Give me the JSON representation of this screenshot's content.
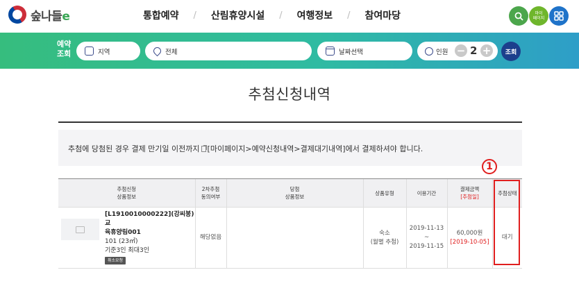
{
  "header": {
    "logo_text": "숲나들",
    "logo_suffix": "e",
    "nav": [
      "통합예약",
      "산림휴양시설",
      "여행정보",
      "참여마당"
    ],
    "separator": "/",
    "mypage_label_line1": "마이",
    "mypage_label_line2": "페이지"
  },
  "search_bar": {
    "label_line1": "예약",
    "label_line2": "조회",
    "region_label": "지역",
    "facility_label": "전체",
    "date_label": "날짜선택",
    "people_label": "인원",
    "people_count": "2",
    "minus": "−",
    "plus": "+",
    "submit_label": "조회"
  },
  "page": {
    "title": "추첨신청내역",
    "notice_before": "추첨에 당첨된 경우 결제 만기일 이전까지",
    "notice_after": "[마이페이지>예약신청내역>결제대기내역]에서 결제하셔야 합니다."
  },
  "table": {
    "headers": {
      "product_line1": "추첨신청",
      "product_line2": "상품정보",
      "second_line1": "2차추첨",
      "second_line2": "동의여부",
      "win_line1": "당첨",
      "win_line2": "상품정보",
      "type": "상품유형",
      "period": "이용기간",
      "amount_line1": "결제금액",
      "amount_line2": "[추첨일]",
      "status": "추첨상태"
    },
    "row": {
      "product_name_line1": "[L1910010000222](강씨봉)교",
      "product_name_line2": "육휴양림001",
      "room": "101 (23㎡)",
      "capacity": "기준3인 최대3인",
      "cancel_tag": "취소요청",
      "second_draw": "해당없음",
      "win_info": "",
      "type_line1": "숙소",
      "type_line2": "(월별 추첨)",
      "period_start": "2019-11-13",
      "period_sep": "~",
      "period_end": "2019-11-15",
      "amount": "60,000원",
      "draw_date": "[2019-10-05]",
      "status": "대기"
    }
  },
  "annotation": {
    "label": "1"
  },
  "colors": {
    "accent_red": "#e01e1e",
    "bar_green": "#36bd7e",
    "bar_blue": "#2e9ec8",
    "navy": "#1c3f8c"
  }
}
